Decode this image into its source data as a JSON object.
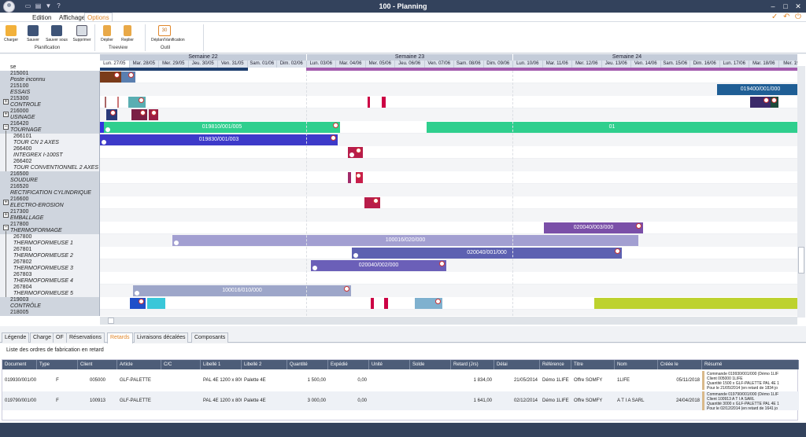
{
  "window": {
    "title": "100 - Planning"
  },
  "menu": {
    "items": [
      "Edition",
      "Affichage",
      "Options"
    ],
    "active": "Options"
  },
  "ribbon": {
    "groups": [
      {
        "label": "Planification",
        "buttons": [
          "Charger",
          "Sauver",
          "Sauver sous",
          "Supprimer"
        ]
      },
      {
        "label": "Treeview",
        "buttons": [
          "Déplier",
          "Replier"
        ]
      },
      {
        "label": "Outil",
        "buttons": [
          "Déplan/Vanification"
        ]
      }
    ],
    "calendar_icon_text": "30"
  },
  "gantt": {
    "weeks": [
      "Semaine 22",
      "Semaine 23",
      "Semaine 24"
    ],
    "days": [
      "Lun. 27/05",
      "Mar. 28/05",
      "Mer. 29/05",
      "Jeu. 30/05",
      "Ven. 31/05",
      "Sam. 01/06",
      "Dim. 02/06",
      "Lun. 03/06",
      "Mar. 04/06",
      "Mer. 05/06",
      "Jeu. 06/06",
      "Ven. 07/06",
      "Sam. 08/06",
      "Dim. 09/06",
      "Lun. 10/06",
      "Mar. 11/06",
      "Mer. 12/06",
      "Jeu. 13/06",
      "Ven. 14/06",
      "Sam. 15/06",
      "Dim. 16/06",
      "Lun. 17/06",
      "Mar. 18/06",
      "Mer. 19/0"
    ],
    "top_label": "se",
    "rows": [
      {
        "code": "215001",
        "name": "Poste inconnu"
      },
      {
        "code": "215100",
        "name": "ESSAIS"
      },
      {
        "code": "215300",
        "name": "CONTROLE",
        "toggle": "+"
      },
      {
        "code": "216000",
        "name": "USINAGE",
        "toggle": "+"
      },
      {
        "code": "216420",
        "name": "TOURNAGE",
        "toggle": "-"
      },
      {
        "code": "266101",
        "name": "TOUR CN 2 AXES",
        "child": true
      },
      {
        "code": "266400",
        "name": "INTEGREX I-100ST",
        "child": true
      },
      {
        "code": "266402",
        "name": "TOUR CONVENTIONNEL 2 AXES",
        "child": true
      },
      {
        "code": "216500",
        "name": "SOUDURE"
      },
      {
        "code": "216520",
        "name": "RECTIFICATION CYLINDRIQUE"
      },
      {
        "code": "216600",
        "name": "ELECTRO-EROSION",
        "toggle": "+"
      },
      {
        "code": "217300",
        "name": "EMBALLAGE",
        "toggle": "+"
      },
      {
        "code": "217800",
        "name": "THERMOFORMAGE",
        "toggle": "-"
      },
      {
        "code": "267800",
        "name": "THERMOFORMEUSE 1",
        "child": true
      },
      {
        "code": "267801",
        "name": "THERMOFORMEUSE 2",
        "child": true
      },
      {
        "code": "267802",
        "name": "THERMOFORMEUSE 3",
        "child": true
      },
      {
        "code": "267803",
        "name": "THERMOFORMEUSE 4",
        "child": true
      },
      {
        "code": "267804",
        "name": "THERMOFORMEUSE 5",
        "child": true
      },
      {
        "code": "219003",
        "name": "CONTRÔLE"
      },
      {
        "code": "218005",
        "name": ""
      }
    ],
    "bar_labels": {
      "b1": "019400/001/000",
      "b2": "019810/001/005",
      "b3": "01",
      "b4": "019830/001/003",
      "b5": "020040/003/000",
      "b6": "100016/020/000",
      "b7": "020040/001/000",
      "b8": "020040/002/000",
      "b9": "100016/010/000"
    }
  },
  "tabs": [
    "Légende",
    "Charge",
    "OF",
    "Réservations",
    "Retards",
    "Livraisons décalées",
    "Composants"
  ],
  "active_tab": "Retards",
  "panel": {
    "title": "Liste des ordres de fabrication en retard",
    "columns": [
      "Document",
      "Type",
      "Client",
      "Article",
      "C/C",
      "Libellé 1",
      "Libellé 2",
      "Quantité",
      "Expédié",
      "Unité",
      "Solde",
      "Retard (Jrs)",
      "Délai",
      "Référence",
      "Titre",
      "Nom",
      "Créée le",
      "Résumé"
    ],
    "rows": [
      {
        "document": "019930/001/00",
        "type": "F",
        "client": "005000",
        "article": "GLF-PALETTE",
        "cc": "",
        "lib1": "PAL 4E 1200 x 800",
        "lib2": "Palette 4E",
        "qte": "1 500,00",
        "exp": "0,00",
        "unite": "",
        "solde": "",
        "retard": "1 834,00",
        "delai": "21/05/2014",
        "ref": "Démo 1LIFE",
        "titre": "Offre SOMFY",
        "nom": "1LIFE",
        "creee": "05/11/2018",
        "resume": [
          "Commande 019930/001/000 (Démo 1LIF",
          "Client 005000 1LIFE",
          "Quantité 1500 x GLF-PALETTE PAL 4E 1",
          "Pour le 21/05/2014 (en retard de 1834 jo"
        ]
      },
      {
        "document": "019790/001/00",
        "type": "F",
        "client": "100913",
        "article": "GLF-PALETTE",
        "cc": "",
        "lib1": "PAL 4E 1200 x 800",
        "lib2": "Palette 4E",
        "qte": "3 000,00",
        "exp": "0,00",
        "unite": "",
        "solde": "",
        "retard": "1 641,00",
        "delai": "02/12/2014",
        "ref": "Démo 1LIFE",
        "titre": "Offre SOMFY",
        "nom": "A T I A SARL",
        "creee": "24/04/2018",
        "resume": [
          "Commande 019790/001/000 (Démo 1LIF",
          "Client 100913 A T I A SARL",
          "Quantité 3000 x GLF-PALETTE PAL 4E 1",
          "Pour le 02/12/2014 (en retard de 1641 jo"
        ]
      }
    ]
  },
  "colors": {
    "titlebar": "#33425c",
    "accent": "#e0862a",
    "tournage": "#2fcf8e",
    "tourcn": "#3d3ac9",
    "thermo1": "#a29fd1",
    "thermo2": "#5d61b1",
    "thermo3": "#6b5fb8",
    "thermoform": "#7a4fa8",
    "essais": "#1f5e95",
    "controle": "#bdd22e"
  }
}
